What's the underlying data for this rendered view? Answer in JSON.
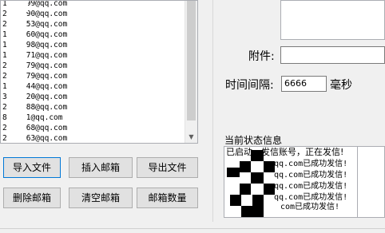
{
  "email_list": {
    "rows": [
      {
        "prefix": "1",
        "suffix": "99@qq.com"
      },
      {
        "prefix": "2",
        "suffix": "90@qq.com"
      },
      {
        "prefix": "2",
        "suffix": "53@qq.com"
      },
      {
        "prefix": "1",
        "suffix": "60@qq.com"
      },
      {
        "prefix": "1",
        "suffix": "98@qq.com"
      },
      {
        "prefix": "1",
        "suffix": "71@qq.com"
      },
      {
        "prefix": "2",
        "suffix": "79@qq.com"
      },
      {
        "prefix": "2",
        "suffix": "79@qq.com"
      },
      {
        "prefix": "1",
        "suffix": "44@qq.com"
      },
      {
        "prefix": "3",
        "suffix": "20@qq.com"
      },
      {
        "prefix": "2",
        "suffix": "88@qq.com"
      },
      {
        "prefix": "8",
        "suffix": "1@qq.com"
      },
      {
        "prefix": "2",
        "suffix": "68@qq.com"
      },
      {
        "prefix": "2",
        "suffix": "63@qq.com"
      }
    ]
  },
  "buttons": {
    "import_file": "导入文件",
    "insert_email": "插入邮箱",
    "export_file": "导出文件",
    "delete_email": "删除邮箱",
    "clear_email": "清空邮箱",
    "email_count": "邮箱数量"
  },
  "attachment": {
    "label": "附件:",
    "value": ""
  },
  "interval": {
    "label": "时间间隔:",
    "value": "6666",
    "unit": "毫秒"
  },
  "status": {
    "title": "当前状态信息",
    "lines": [
      "已启动，发信账号，正在发信!",
      "qq.com已成功发信!",
      "qq.com已成功发信!",
      "qq.com已成功发信!",
      "qq.com已成功发信!",
      "com已成功发信!"
    ]
  },
  "colors": {
    "focus_border": "#0078d7",
    "button_bg": "#e1e1e1",
    "window_bg": "#f0f0f0"
  }
}
